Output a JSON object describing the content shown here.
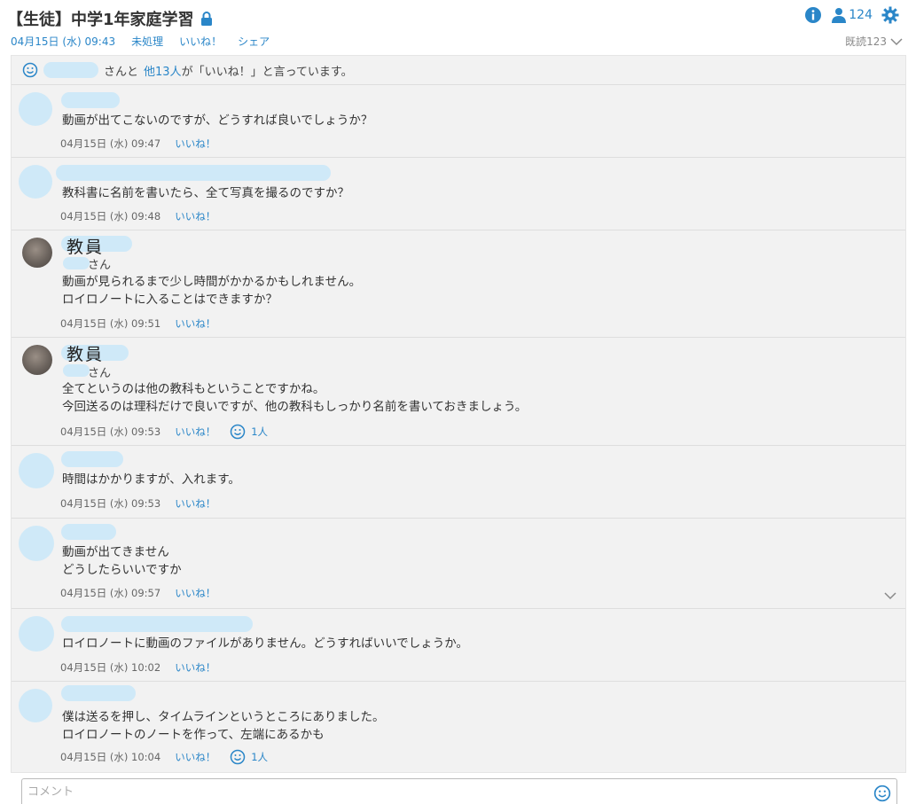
{
  "header": {
    "title": "【生徒】中学1年家庭学習",
    "date": "04月15日 (水) 09:43",
    "status": "未処理",
    "like": "いいね！",
    "share": "シェア",
    "member_count": "124",
    "read_count": "既読123"
  },
  "like_summary": {
    "san": "さんと",
    "others": "他13人",
    "rest": "が「いいね！」と言っています。"
  },
  "messages": [
    {
      "body": [
        "動画が出てこないのですが、どうすれば良いでしょうか？"
      ],
      "time": "04月15日 (水) 09:47",
      "like": "いいね！"
    },
    {
      "body": [
        "教科書に名前を書いたら、全て写真を撮るのですか？"
      ],
      "time": "04月15日 (水) 09:48",
      "like": "いいね！"
    },
    {
      "teacher": "教員",
      "san": "さん",
      "body": [
        "動画が見られるまで少し時間がかかるかもしれません。",
        "ロイロノートに入ることはできますか？"
      ],
      "time": "04月15日 (水) 09:51",
      "like": "いいね！"
    },
    {
      "teacher": "教員",
      "san": "さん",
      "body": [
        "全てというのは他の教科もということですかね。",
        "今回送るのは理科だけで良いですが、他の教科もしっかり名前を書いておきましょう。"
      ],
      "time": "04月15日 (水) 09:53",
      "like": "いいね！",
      "reactions": "1人"
    },
    {
      "body": [
        "時間はかかりますが、入れます。"
      ],
      "time": "04月15日 (水) 09:53",
      "like": "いいね！"
    },
    {
      "body": [
        "動画が出てきません",
        "どうしたらいいですか"
      ],
      "time": "04月15日 (水) 09:57",
      "like": "いいね！"
    },
    {
      "body": [
        "ロイロノートに動画のファイルがありません。どうすればいいでしょうか。"
      ],
      "time": "04月15日 (水) 10:02",
      "like": "いいね！"
    },
    {
      "body": [
        "僕は送るを押し、タイムラインというところにありました。",
        "ロイロノートのノートを作って、左端にあるかも"
      ],
      "time": "04月15日 (水) 10:04",
      "like": "いいね！",
      "reactions": "1人"
    }
  ],
  "comment": {
    "placeholder": "コメント"
  }
}
